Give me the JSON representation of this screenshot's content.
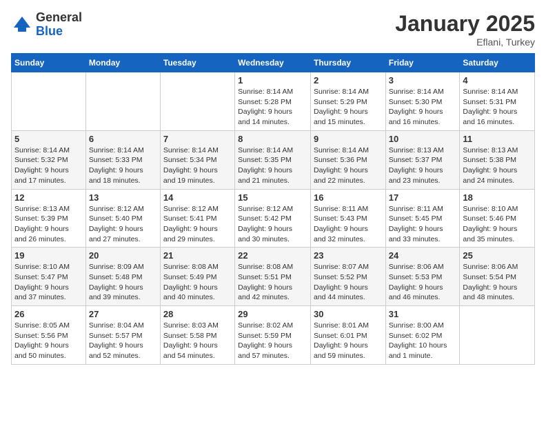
{
  "logo": {
    "general": "General",
    "blue": "Blue"
  },
  "title": "January 2025",
  "location": "Eflani, Turkey",
  "weekdays": [
    "Sunday",
    "Monday",
    "Tuesday",
    "Wednesday",
    "Thursday",
    "Friday",
    "Saturday"
  ],
  "weeks": [
    [
      {
        "day": "",
        "info": ""
      },
      {
        "day": "",
        "info": ""
      },
      {
        "day": "",
        "info": ""
      },
      {
        "day": "1",
        "info": "Sunrise: 8:14 AM\nSunset: 5:28 PM\nDaylight: 9 hours\nand 14 minutes."
      },
      {
        "day": "2",
        "info": "Sunrise: 8:14 AM\nSunset: 5:29 PM\nDaylight: 9 hours\nand 15 minutes."
      },
      {
        "day": "3",
        "info": "Sunrise: 8:14 AM\nSunset: 5:30 PM\nDaylight: 9 hours\nand 16 minutes."
      },
      {
        "day": "4",
        "info": "Sunrise: 8:14 AM\nSunset: 5:31 PM\nDaylight: 9 hours\nand 16 minutes."
      }
    ],
    [
      {
        "day": "5",
        "info": "Sunrise: 8:14 AM\nSunset: 5:32 PM\nDaylight: 9 hours\nand 17 minutes."
      },
      {
        "day": "6",
        "info": "Sunrise: 8:14 AM\nSunset: 5:33 PM\nDaylight: 9 hours\nand 18 minutes."
      },
      {
        "day": "7",
        "info": "Sunrise: 8:14 AM\nSunset: 5:34 PM\nDaylight: 9 hours\nand 19 minutes."
      },
      {
        "day": "8",
        "info": "Sunrise: 8:14 AM\nSunset: 5:35 PM\nDaylight: 9 hours\nand 21 minutes."
      },
      {
        "day": "9",
        "info": "Sunrise: 8:14 AM\nSunset: 5:36 PM\nDaylight: 9 hours\nand 22 minutes."
      },
      {
        "day": "10",
        "info": "Sunrise: 8:13 AM\nSunset: 5:37 PM\nDaylight: 9 hours\nand 23 minutes."
      },
      {
        "day": "11",
        "info": "Sunrise: 8:13 AM\nSunset: 5:38 PM\nDaylight: 9 hours\nand 24 minutes."
      }
    ],
    [
      {
        "day": "12",
        "info": "Sunrise: 8:13 AM\nSunset: 5:39 PM\nDaylight: 9 hours\nand 26 minutes."
      },
      {
        "day": "13",
        "info": "Sunrise: 8:12 AM\nSunset: 5:40 PM\nDaylight: 9 hours\nand 27 minutes."
      },
      {
        "day": "14",
        "info": "Sunrise: 8:12 AM\nSunset: 5:41 PM\nDaylight: 9 hours\nand 29 minutes."
      },
      {
        "day": "15",
        "info": "Sunrise: 8:12 AM\nSunset: 5:42 PM\nDaylight: 9 hours\nand 30 minutes."
      },
      {
        "day": "16",
        "info": "Sunrise: 8:11 AM\nSunset: 5:43 PM\nDaylight: 9 hours\nand 32 minutes."
      },
      {
        "day": "17",
        "info": "Sunrise: 8:11 AM\nSunset: 5:45 PM\nDaylight: 9 hours\nand 33 minutes."
      },
      {
        "day": "18",
        "info": "Sunrise: 8:10 AM\nSunset: 5:46 PM\nDaylight: 9 hours\nand 35 minutes."
      }
    ],
    [
      {
        "day": "19",
        "info": "Sunrise: 8:10 AM\nSunset: 5:47 PM\nDaylight: 9 hours\nand 37 minutes."
      },
      {
        "day": "20",
        "info": "Sunrise: 8:09 AM\nSunset: 5:48 PM\nDaylight: 9 hours\nand 39 minutes."
      },
      {
        "day": "21",
        "info": "Sunrise: 8:08 AM\nSunset: 5:49 PM\nDaylight: 9 hours\nand 40 minutes."
      },
      {
        "day": "22",
        "info": "Sunrise: 8:08 AM\nSunset: 5:51 PM\nDaylight: 9 hours\nand 42 minutes."
      },
      {
        "day": "23",
        "info": "Sunrise: 8:07 AM\nSunset: 5:52 PM\nDaylight: 9 hours\nand 44 minutes."
      },
      {
        "day": "24",
        "info": "Sunrise: 8:06 AM\nSunset: 5:53 PM\nDaylight: 9 hours\nand 46 minutes."
      },
      {
        "day": "25",
        "info": "Sunrise: 8:06 AM\nSunset: 5:54 PM\nDaylight: 9 hours\nand 48 minutes."
      }
    ],
    [
      {
        "day": "26",
        "info": "Sunrise: 8:05 AM\nSunset: 5:56 PM\nDaylight: 9 hours\nand 50 minutes."
      },
      {
        "day": "27",
        "info": "Sunrise: 8:04 AM\nSunset: 5:57 PM\nDaylight: 9 hours\nand 52 minutes."
      },
      {
        "day": "28",
        "info": "Sunrise: 8:03 AM\nSunset: 5:58 PM\nDaylight: 9 hours\nand 54 minutes."
      },
      {
        "day": "29",
        "info": "Sunrise: 8:02 AM\nSunset: 5:59 PM\nDaylight: 9 hours\nand 57 minutes."
      },
      {
        "day": "30",
        "info": "Sunrise: 8:01 AM\nSunset: 6:01 PM\nDaylight: 9 hours\nand 59 minutes."
      },
      {
        "day": "31",
        "info": "Sunrise: 8:00 AM\nSunset: 6:02 PM\nDaylight: 10 hours\nand 1 minute."
      },
      {
        "day": "",
        "info": ""
      }
    ]
  ]
}
